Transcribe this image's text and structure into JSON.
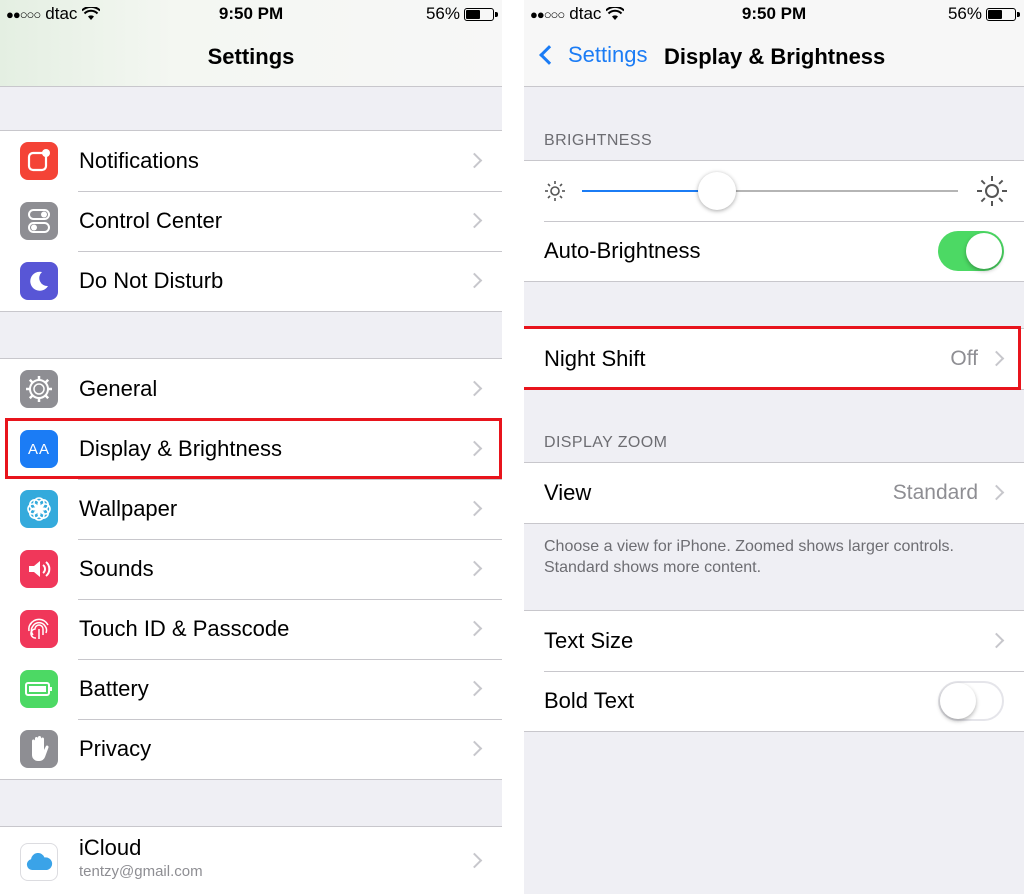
{
  "status_bar": {
    "carrier": "dtac",
    "time": "9:50 PM",
    "battery": "56%",
    "battery_level": 0.56
  },
  "left": {
    "title": "Settings",
    "group1": [
      {
        "label": "Notifications",
        "icon": "notifications-icon",
        "color": "#f44336"
      },
      {
        "label": "Control Center",
        "icon": "control-center-icon",
        "color": "#8e8e93"
      },
      {
        "label": "Do Not Disturb",
        "icon": "moon-icon",
        "color": "#5856d6"
      }
    ],
    "group2": [
      {
        "label": "General",
        "icon": "gear-icon",
        "color": "#8e8e93"
      },
      {
        "label": "Display & Brightness",
        "icon": "display-brightness-icon",
        "color": "#1b7cf5"
      },
      {
        "label": "Wallpaper",
        "icon": "wallpaper-icon",
        "color": "#34aadc"
      },
      {
        "label": "Sounds",
        "icon": "speaker-icon",
        "color": "#f0375a"
      },
      {
        "label": "Touch ID & Passcode",
        "icon": "fingerprint-icon",
        "color": "#f0375a"
      },
      {
        "label": "Battery",
        "icon": "battery-icon",
        "color": "#4cd964"
      },
      {
        "label": "Privacy",
        "icon": "hand-icon",
        "color": "#8e8e93"
      }
    ],
    "icloud": {
      "title": "iCloud",
      "subtitle": "tentzy@gmail.com",
      "icon": "cloud-icon"
    },
    "icon_glyph_aa": "AA"
  },
  "right": {
    "back_label": "Settings",
    "title": "Display & Brightness",
    "brightness_header": "BRIGHTNESS",
    "brightness_level": 0.36,
    "auto_brightness": {
      "label": "Auto-Brightness",
      "on": true
    },
    "night_shift": {
      "label": "Night Shift",
      "value": "Off"
    },
    "display_zoom_header": "DISPLAY ZOOM",
    "view": {
      "label": "View",
      "value": "Standard"
    },
    "zoom_note": "Choose a view for iPhone. Zoomed shows larger controls. Standard shows more content.",
    "text_size": {
      "label": "Text Size"
    },
    "bold_text": {
      "label": "Bold Text",
      "on": false
    }
  },
  "colors": {
    "accent": "#1b7cf5",
    "highlight": "#e8141c",
    "toggle_on": "#4cd964"
  }
}
